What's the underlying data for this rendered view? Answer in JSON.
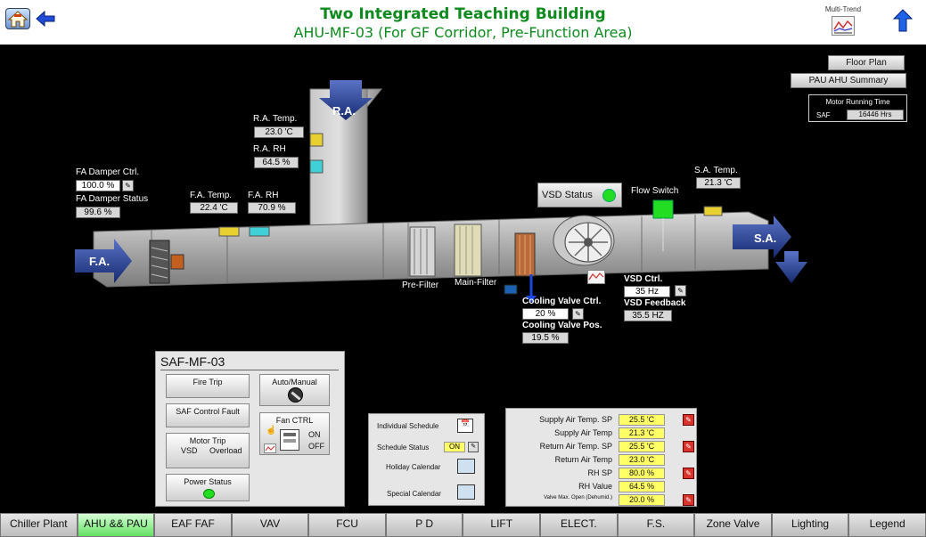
{
  "header": {
    "title": "Two Integrated Teaching Building",
    "subtitle": "AHU-MF-03 (For GF Corridor, Pre-Function Area)",
    "multitrend_label": "Multi-Trend"
  },
  "top_buttons": {
    "floor_plan": "Floor Plan",
    "pau_ahu_summary": "PAU AHU Summary"
  },
  "motor_running": {
    "title": "Motor Running Time",
    "label": "SAF",
    "value": "16446 Hrs"
  },
  "diagram": {
    "ra_arrow": "R.A.",
    "fa_arrow": "F.A.",
    "sa_arrow": "S.A.",
    "ra_temp_label": "R.A. Temp.",
    "ra_temp_value": "23.0 'C",
    "ra_rh_label": "R.A. RH",
    "ra_rh_value": "64.5 %",
    "fa_damper_ctrl_label": "FA Damper Ctrl.",
    "fa_damper_ctrl_value": "100.0 %",
    "fa_damper_status_label": "FA Damper Status",
    "fa_damper_status_value": "99.6 %",
    "fa_temp_label": "F.A. Temp.",
    "fa_temp_value": "22.4 'C",
    "fa_rh_label": "F.A. RH",
    "fa_rh_value": "70.9 %",
    "vsd_status_label": "VSD Status",
    "flow_switch_label": "Flow Switch",
    "sa_temp_label": "S.A. Temp.",
    "sa_temp_value": "21.3 'C",
    "pre_filter_label": "Pre-Filter",
    "main_filter_label": "Main-Filter",
    "cooling_valve_ctrl_label": "Cooling Valve Ctrl.",
    "cooling_valve_ctrl_value": "20 %",
    "cooling_valve_pos_label": "Cooling Valve Pos.",
    "cooling_valve_pos_value": "19.5 %",
    "vsd_ctrl_label": "VSD Ctrl.",
    "vsd_ctrl_value": "35 Hz",
    "vsd_feedback_label": "VSD Feedback",
    "vsd_feedback_value": "35.5 HZ"
  },
  "saf_panel": {
    "title": "SAF-MF-03",
    "fire_trip": "Fire Trip",
    "auto_manual": "Auto/Manual",
    "saf_control_fault": "SAF Control Fault",
    "fan_ctrl": "Fan CTRL",
    "fan_on": "ON",
    "fan_off": "OFF",
    "motor_trip": "Motor Trip",
    "vsd": "VSD",
    "overload": "Overload",
    "power_status": "Power Status"
  },
  "schedule_panel": {
    "individual_schedule": "Individual Schedule",
    "schedule_status": "Schedule Status",
    "schedule_status_value": "ON",
    "holiday_calendar": "Holiday Calendar",
    "special_calendar": "Special Calendar"
  },
  "setpoints": [
    {
      "label": "Supply Air Temp. SP",
      "value": "25.5 'C",
      "editable": true
    },
    {
      "label": "Supply Air Temp",
      "value": "21.3 'C",
      "editable": false
    },
    {
      "label": "Return Air Temp. SP",
      "value": "25.5 'C",
      "editable": true
    },
    {
      "label": "Return Air Temp",
      "value": "23.0 'C",
      "editable": false
    },
    {
      "label": "RH SP",
      "value": "80.0 %",
      "editable": true
    },
    {
      "label": "RH Value",
      "value": "64.5 %",
      "editable": false
    },
    {
      "label": "Valve Max. Open (Dehumid.)",
      "value": "20.0 %",
      "editable": true
    }
  ],
  "nav": {
    "tabs": [
      "Chiller Plant",
      "AHU && PAU",
      "EAF FAF",
      "VAV",
      "FCU",
      "P D",
      "LIFT",
      "ELECT.",
      "F.S.",
      "Zone Valve",
      "Lighting",
      "Legend"
    ],
    "active": 1
  },
  "colors": {
    "title_green": "#0e8a1e",
    "status_green": "#22dd22",
    "duct_grey": "#a9a9a9",
    "arrow_blue": "#2a3f8f",
    "setpoint_yellow": "#ffff66"
  }
}
